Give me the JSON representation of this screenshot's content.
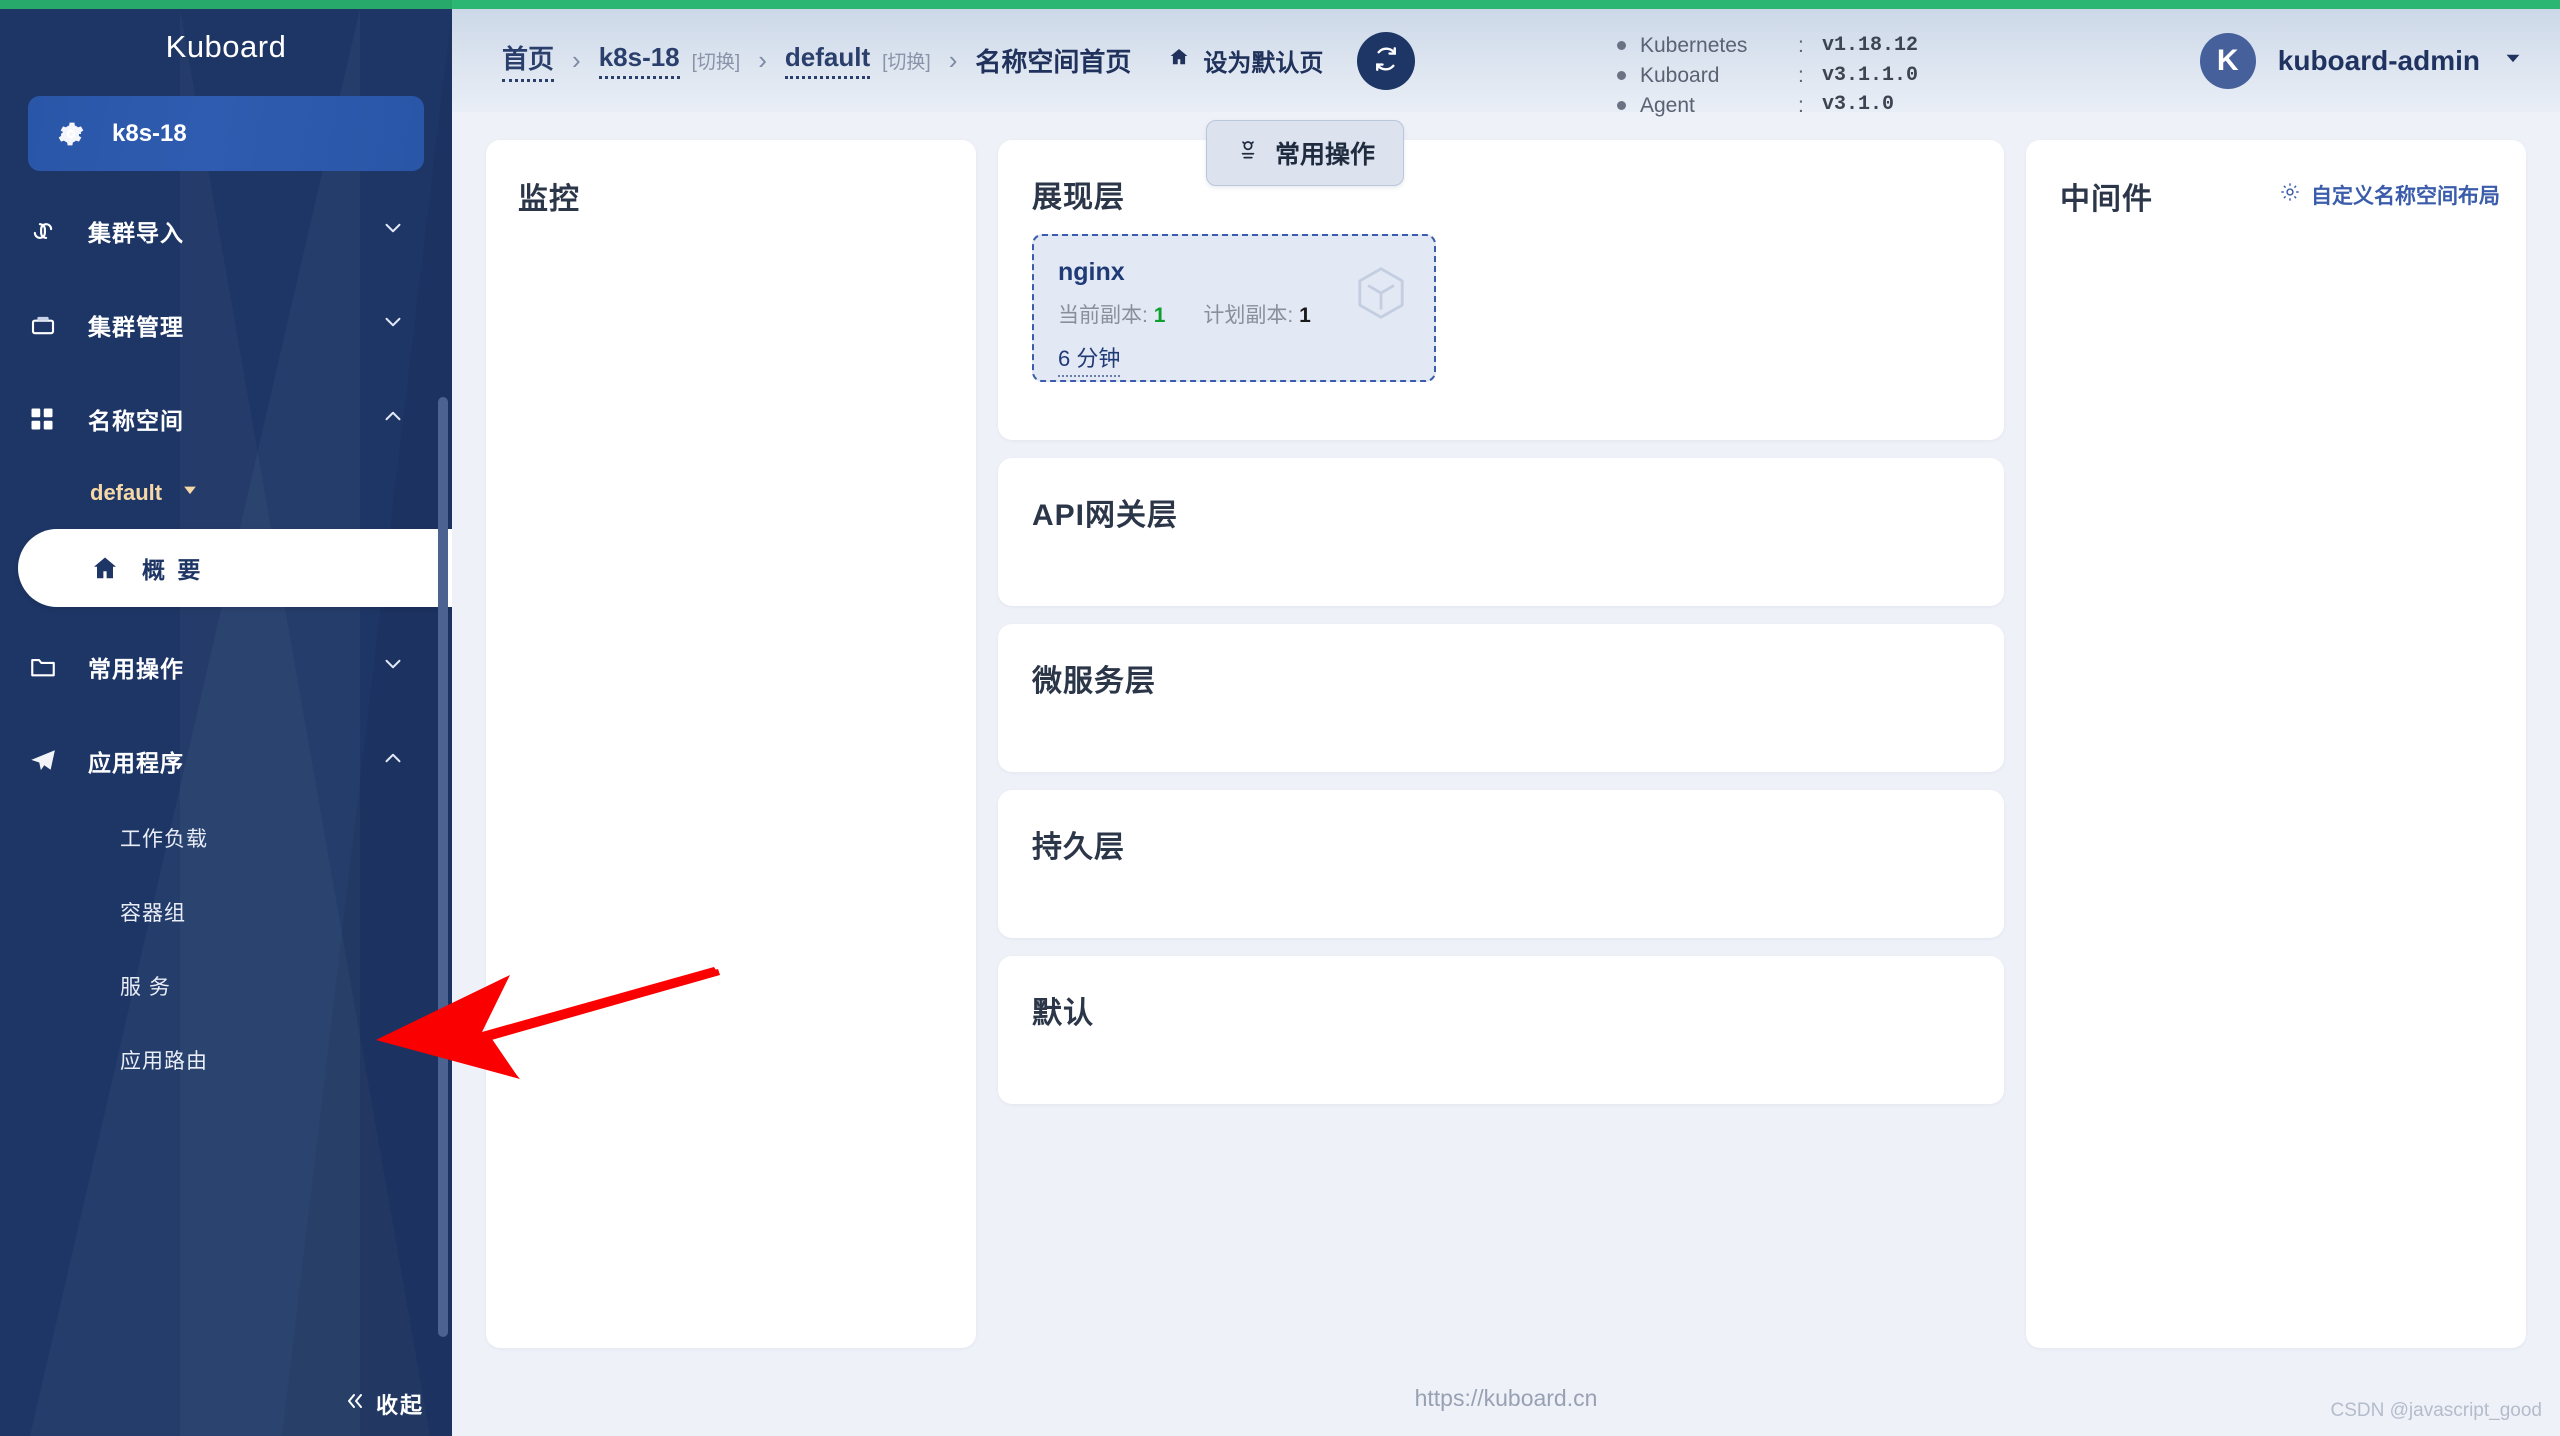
{
  "brand": {
    "title": "Kuboard"
  },
  "sidebar": {
    "cluster": {
      "label": "k8s-18",
      "icon": "gear-icon"
    },
    "groups": [
      {
        "label": "集群导入",
        "icon": "link-icon",
        "expanded": false,
        "chevron": "chevron-down-icon"
      },
      {
        "label": "集群管理",
        "icon": "box-icon",
        "expanded": false,
        "chevron": "chevron-down-icon"
      },
      {
        "label": "名称空间",
        "icon": "grid-icon",
        "expanded": true,
        "chevron": "chevron-up-icon"
      }
    ],
    "namespace": {
      "label": "default",
      "caret": "caret-down-icon"
    },
    "active_item": {
      "label": "概 要",
      "icon": "home-icon"
    },
    "ops_group": {
      "label": "常用操作",
      "icon": "folder-icon",
      "chevron": "chevron-down-icon"
    },
    "apps_group": {
      "label": "应用程序",
      "icon": "send-icon",
      "chevron": "chevron-up-icon"
    },
    "apps_items": [
      {
        "label": "工作负载"
      },
      {
        "label": "容器组"
      },
      {
        "label": "服 务"
      },
      {
        "label": "应用路由"
      }
    ],
    "collapse": {
      "label": "收起",
      "icon": "double-chevron-left-icon"
    }
  },
  "header": {
    "breadcrumb": [
      {
        "text": "首页",
        "type": "link"
      },
      {
        "text": "k8s-18",
        "type": "link",
        "switch": "[切换]"
      },
      {
        "text": "default",
        "type": "link",
        "switch": "[切换]"
      },
      {
        "text": "名称空间首页",
        "type": "plain"
      }
    ],
    "separator": "›",
    "set_default": {
      "label": "设为默认页",
      "icon": "home-icon"
    },
    "refresh": {
      "icon": "refresh-icon"
    },
    "versions": [
      {
        "name": "Kubernetes",
        "colon": ":",
        "value": "v1.18.12"
      },
      {
        "name": "Kuboard",
        "colon": ":",
        "value": "v3.1.1.0"
      },
      {
        "name": "Agent",
        "colon": ":",
        "value": "v3.1.0"
      }
    ],
    "user": {
      "initial": "K",
      "name": "kuboard-admin",
      "caret": "caret-down-icon"
    }
  },
  "main": {
    "monitor_panel": {
      "title": "监控"
    },
    "middle": {
      "ops_button": {
        "label": "常用操作",
        "icon": "ops-icon"
      },
      "layers": [
        {
          "title": "展现层",
          "workloads": [
            {
              "name": "nginx",
              "current_label": "当前副本:",
              "current_value": "1",
              "desired_label": "计划副本:",
              "desired_value": "1",
              "age": "6 分钟",
              "icon": "cube-icon"
            }
          ]
        },
        {
          "title": "API网关层",
          "workloads": []
        },
        {
          "title": "微服务层",
          "workloads": []
        },
        {
          "title": "持久层",
          "workloads": []
        },
        {
          "title": "默认",
          "workloads": []
        }
      ]
    },
    "right_panel": {
      "title": "中间件",
      "custom_layout": {
        "label": "自定义名称空间布局",
        "icon": "gear-icon"
      }
    },
    "footer_url": "https://kuboard.cn",
    "watermark": "CSDN @javascript_good"
  },
  "colors": {
    "sidebar_bg": "#1e3666",
    "accent_green": "#2bb673",
    "active_pill": "#ffffff",
    "namespace_text": "#f7d9a8",
    "replica_ok": "#0e9f2e",
    "link_blue": "#3a5cab",
    "arrow_red": "#ff0000"
  }
}
